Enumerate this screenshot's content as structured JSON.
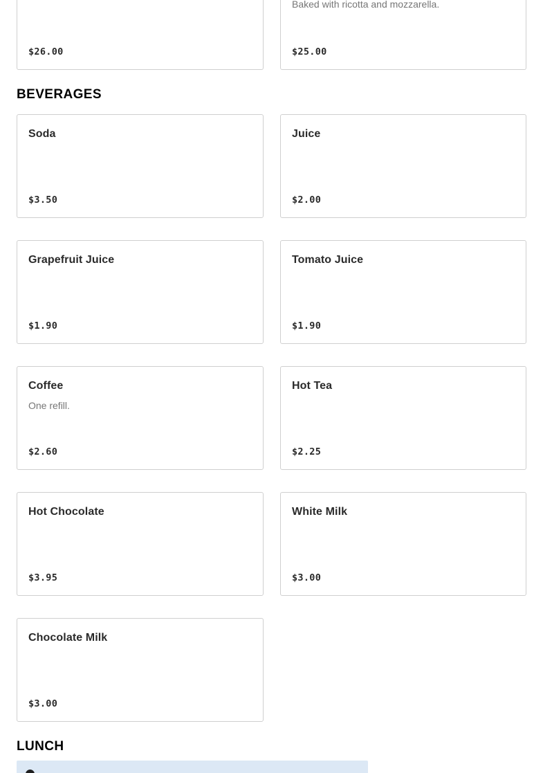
{
  "top_row": {
    "left": {
      "price": "$26.00"
    },
    "right": {
      "description": "Baked with ricotta and mozzarella.",
      "price": "$25.00"
    }
  },
  "beverages": {
    "title": "BEVERAGES",
    "items": [
      {
        "name": "Soda",
        "description": "",
        "price": "$3.50"
      },
      {
        "name": "Juice",
        "description": "",
        "price": "$2.00"
      },
      {
        "name": "Grapefruit Juice",
        "description": "",
        "price": "$1.90"
      },
      {
        "name": "Tomato Juice",
        "description": "",
        "price": "$1.90"
      },
      {
        "name": "Coffee",
        "description": "One refill.",
        "price": "$2.60"
      },
      {
        "name": "Hot Tea",
        "description": "",
        "price": "$2.25"
      },
      {
        "name": "Hot Chocolate",
        "description": "",
        "price": "$3.95"
      },
      {
        "name": "White Milk",
        "description": "",
        "price": "$3.00"
      },
      {
        "name": "Chocolate Milk",
        "description": "",
        "price": "$3.00"
      }
    ]
  },
  "lunch": {
    "title": "LUNCH",
    "info_icon": "info-icon",
    "info_color": "#dce8f5"
  }
}
